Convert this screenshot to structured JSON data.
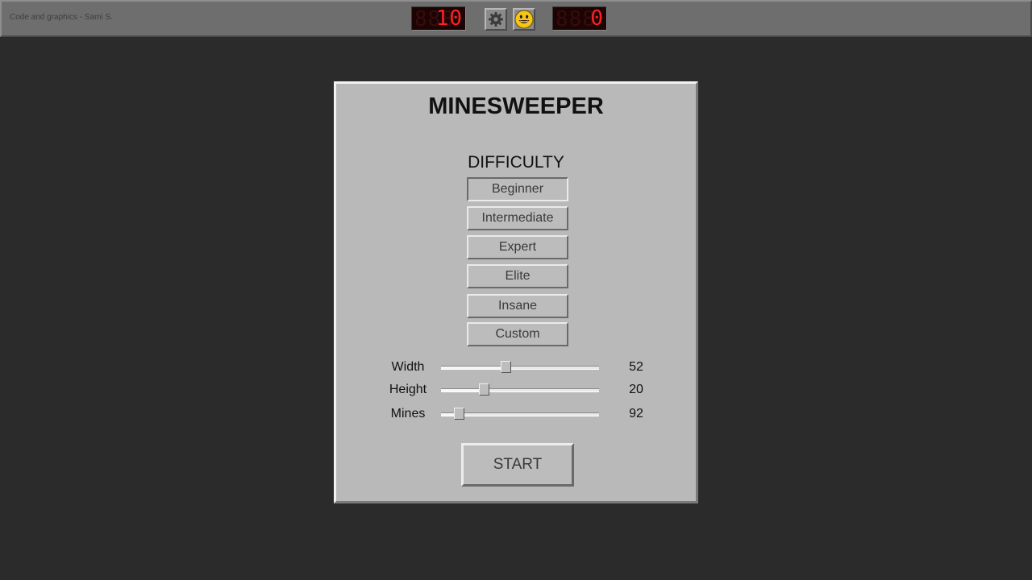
{
  "topbar": {
    "credits": "Code and graphics - Sami S.",
    "mine_counter": {
      "value": "10",
      "ghost": "888"
    },
    "timer": {
      "value": "0",
      "ghost": "888"
    },
    "settings_icon": "gear-icon",
    "face_icon": "smiley-face-icon"
  },
  "menu": {
    "title": "MINESWEEPER",
    "difficulty_label": "DIFFICULTY",
    "difficulties": [
      {
        "label": "Beginner",
        "selected": true
      },
      {
        "label": "Intermediate",
        "selected": false
      },
      {
        "label": "Expert",
        "selected": false
      },
      {
        "label": "Elite",
        "selected": false
      },
      {
        "label": "Insane",
        "selected": false
      },
      {
        "label": "Custom",
        "selected": false
      }
    ],
    "sliders": [
      {
        "label": "Width",
        "value": "52",
        "fraction": 0.41
      },
      {
        "label": "Height",
        "value": "20",
        "fraction": 0.27
      },
      {
        "label": "Mines",
        "value": "92",
        "fraction": 0.11
      }
    ],
    "start_label": "START"
  },
  "colors": {
    "background": "#2b2b2b",
    "topbar": "#6e6e6e",
    "panel": "#b9b9b9",
    "led_digit": "#ff2020",
    "led_background": "#1a0404",
    "smiley": "#f5c518"
  }
}
